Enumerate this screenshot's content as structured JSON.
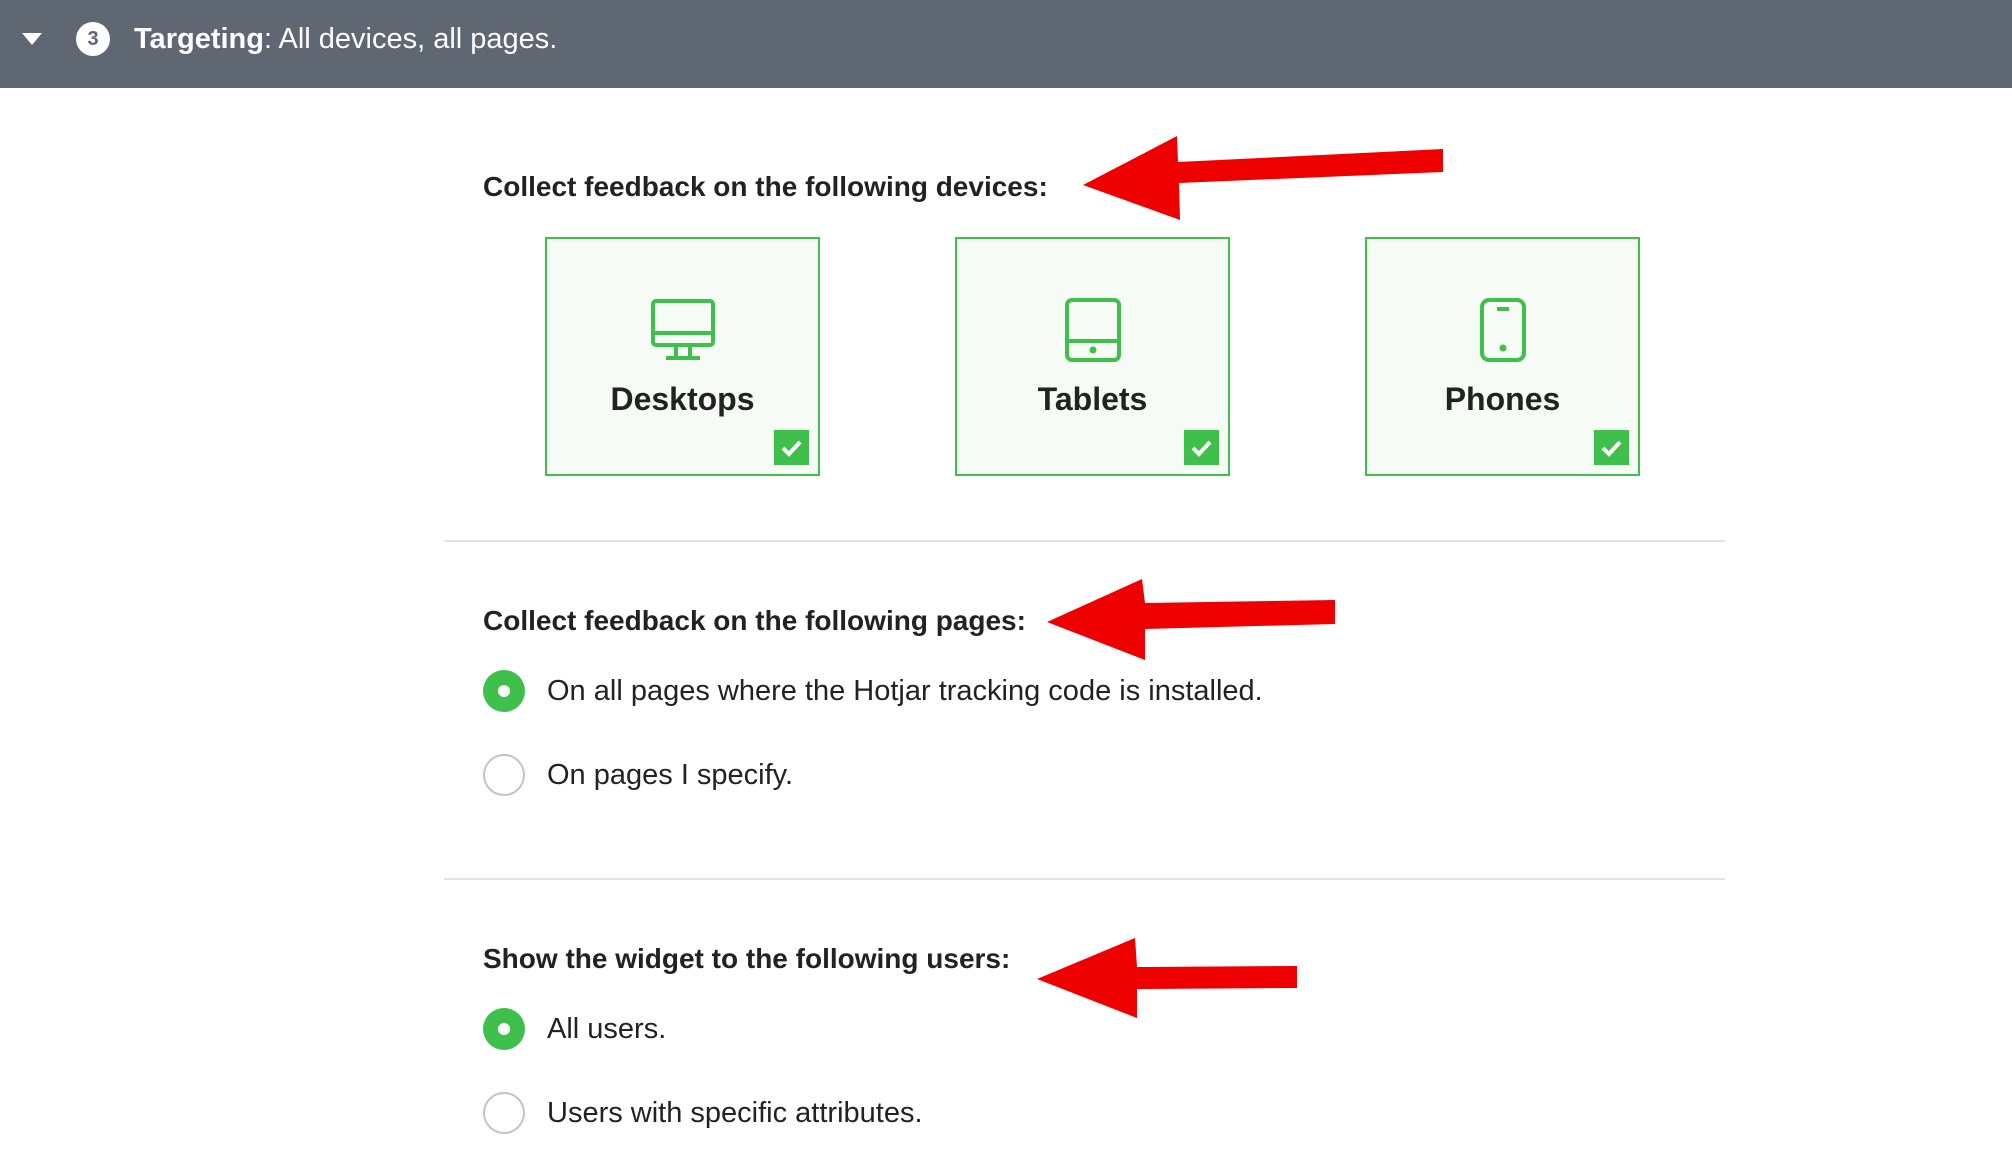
{
  "header": {
    "step_number": "3",
    "title": "Targeting",
    "summary": ": All devices, all pages."
  },
  "devices": {
    "heading": "Collect feedback on the following devices:",
    "items": [
      {
        "label": "Desktops",
        "icon": "desktop-icon",
        "checked": true
      },
      {
        "label": "Tablets",
        "icon": "tablet-icon",
        "checked": true
      },
      {
        "label": "Phones",
        "icon": "phone-icon",
        "checked": true
      }
    ]
  },
  "pages": {
    "heading": "Collect feedback on the following pages:",
    "options": [
      {
        "label": "On all pages where the Hotjar tracking code is installed.",
        "selected": true
      },
      {
        "label": "On pages I specify.",
        "selected": false
      }
    ]
  },
  "users": {
    "heading": "Show the widget to the following users:",
    "options": [
      {
        "label": "All users.",
        "selected": true
      },
      {
        "label": "Users with specific attributes.",
        "selected": false
      }
    ]
  },
  "colors": {
    "header_bg": "#5e6772",
    "accent_green": "#3fbf4c",
    "card_bg": "#f6fbf5",
    "annotation_red": "#ee0000"
  }
}
